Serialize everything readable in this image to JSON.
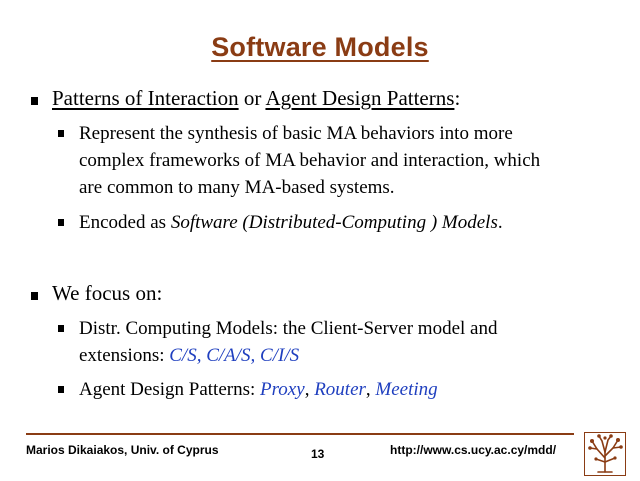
{
  "slide": {
    "title": "Software Models",
    "bullets": [
      {
        "parts": [
          {
            "text": "Patterns of Interaction",
            "underline": true
          },
          {
            "text": " or "
          },
          {
            "text": "Agent Design Patterns",
            "underline": true
          },
          {
            "text": ":"
          }
        ],
        "subbullets": [
          {
            "lines": [
              "Represent the synthesis of basic MA behaviors into more",
              "complex frameworks of MA behavior and interaction, which",
              "are common to many MA-based systems."
            ]
          },
          {
            "prefix": "Encoded as ",
            "italic": "Software (Distributed-Computing ) Models",
            "suffix": "."
          }
        ]
      },
      {
        "text": "We focus on:",
        "subbullets": [
          {
            "line1": "Distr. Computing Models: the Client-Server model and",
            "line2_prefix": "extensions: ",
            "line2_blue": "C/S, C/A/S, C/I/S"
          },
          {
            "prefix": "Agent Design Patterns: ",
            "items": [
              "Proxy",
              "Router",
              "Meeting"
            ],
            "separator": ", "
          }
        ]
      }
    ]
  },
  "footer": {
    "author": "Marios Dikaiakos, Univ. of Cyprus",
    "page_number": "13",
    "url": "http://www.cs.ucy.ac.cy/mdd/"
  },
  "colors": {
    "title": "#8a3c14",
    "rule": "#8a3c14",
    "highlight": "#1f3fbf"
  },
  "icons": {
    "logo": "tree-logo-icon"
  }
}
